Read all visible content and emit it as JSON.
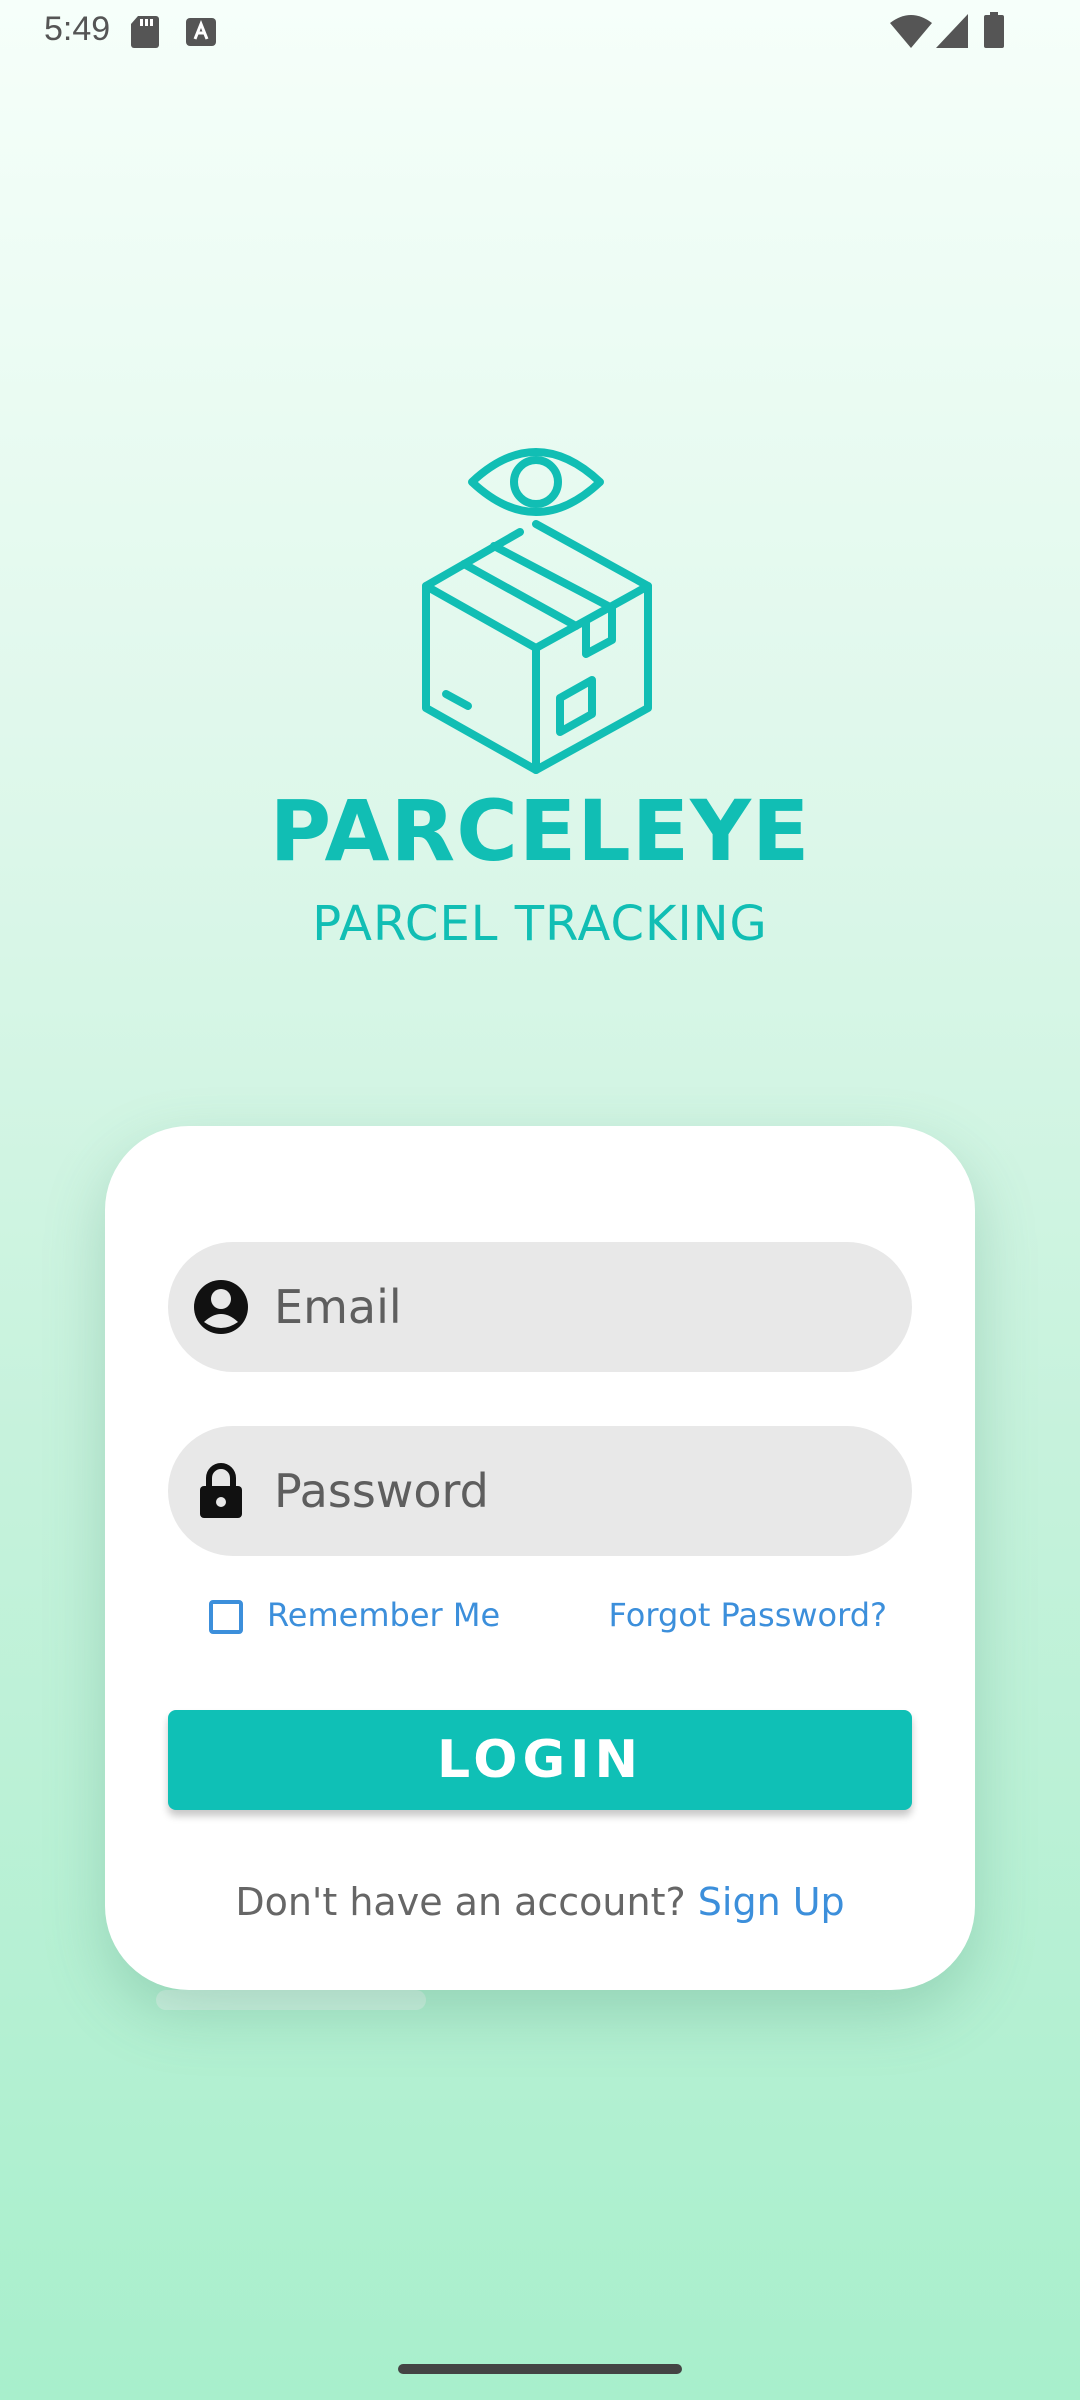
{
  "status_bar": {
    "time": "5:49"
  },
  "brand": {
    "title": "PARCELEYE",
    "subtitle": "PARCEL TRACKING",
    "accent_color": "#11beb4"
  },
  "login_form": {
    "email_placeholder": "Email",
    "email_value": "",
    "password_placeholder": "Password",
    "password_value": "",
    "remember_me_label": "Remember Me",
    "remember_me_checked": false,
    "forgot_password_label": "Forgot Password?",
    "login_button_label": "LOGIN",
    "signup_prompt": "Don't have an account?",
    "signup_link_label": "Sign Up",
    "link_color": "#3c8fdb",
    "button_color": "#0fc0b6"
  },
  "icons": {
    "email_field_icon": "account-circle-icon",
    "password_field_icon": "lock-icon",
    "logo_icon": "eye-box-logo"
  }
}
